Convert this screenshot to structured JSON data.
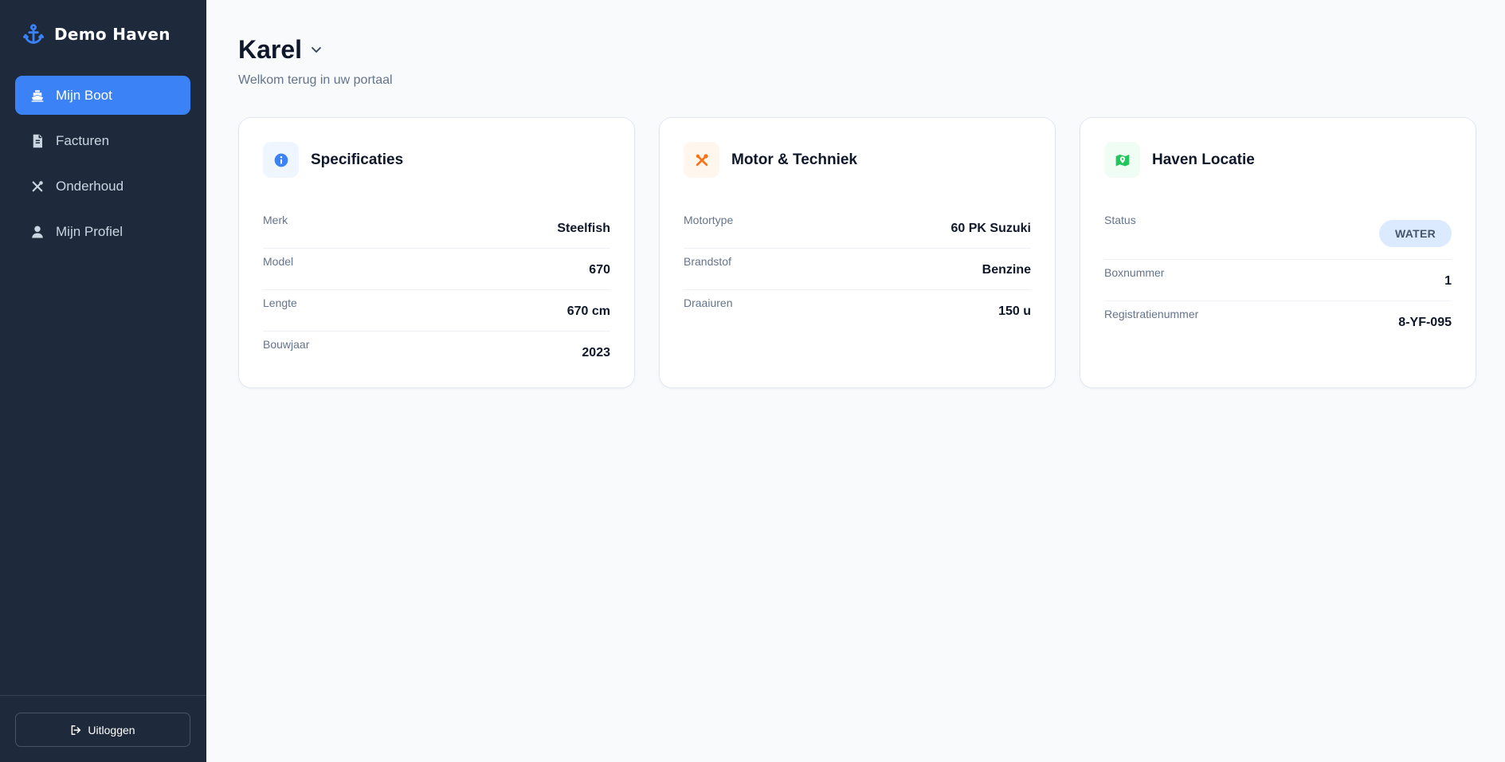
{
  "app": {
    "name": "Demo Haven",
    "brand_icon": "anchor-icon",
    "accent": "#3b82f6",
    "sidebar_bg": "#1e293b"
  },
  "sidebar": {
    "items": [
      {
        "label": "Mijn Boot",
        "icon": "ship-icon",
        "active": true
      },
      {
        "label": "Facturen",
        "icon": "invoice-icon",
        "active": false
      },
      {
        "label": "Onderhoud",
        "icon": "tools-icon",
        "active": false
      },
      {
        "label": "Mijn Profiel",
        "icon": "user-icon",
        "active": false
      }
    ],
    "logout_label": "Uitloggen",
    "logout_icon": "logout-icon"
  },
  "header": {
    "title": "Karel",
    "subtitle": "Welkom terug in uw portaal"
  },
  "cards": {
    "specs": {
      "title": "Specificaties",
      "icon": "info-icon",
      "rows": [
        {
          "label": "Merk",
          "value": "Steelfish"
        },
        {
          "label": "Model",
          "value": "670"
        },
        {
          "label": "Lengte",
          "value": "670 cm"
        },
        {
          "label": "Bouwjaar",
          "value": "2023"
        }
      ]
    },
    "motor": {
      "title": "Motor & Techniek",
      "icon": "tools-icon",
      "rows": [
        {
          "label": "Motortype",
          "value": "60 PK Suzuki"
        },
        {
          "label": "Brandstof",
          "value": "Benzine"
        },
        {
          "label": "Draaiuren",
          "value": "150 u"
        }
      ]
    },
    "location": {
      "title": "Haven Locatie",
      "icon": "map-icon",
      "status_label": "Status",
      "status_value": "WATER",
      "rows": [
        {
          "label": "Boxnummer",
          "value": "1"
        },
        {
          "label": "Registratienummer",
          "value": "8-YF-095"
        }
      ]
    }
  }
}
